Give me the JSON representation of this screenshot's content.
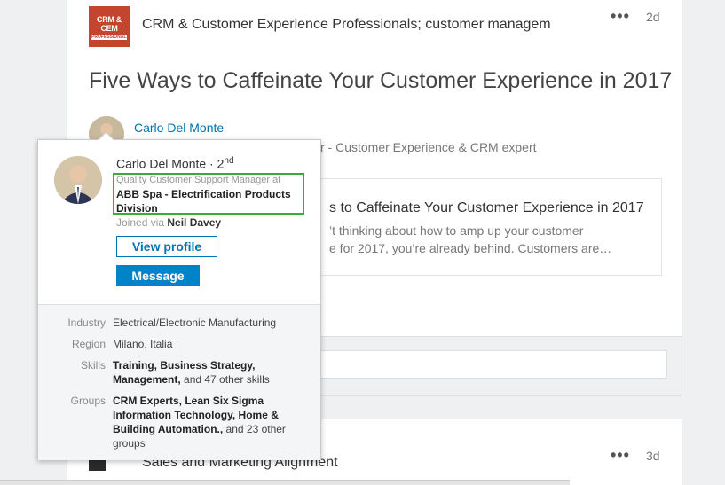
{
  "feed": {
    "post1": {
      "group_name": "CRM & Customer Experience Professionals; customer managem",
      "group_logo_text": "CRM & CEM",
      "group_logo_subtext": "PROFESSIONALS",
      "more_label": "•••",
      "age": "2d",
      "title": "Five Ways to Caffeinate Your Customer Experience in 2017",
      "author_name": "Carlo Del Monte",
      "author_headline": "r - Customer Experience & CRM expert",
      "article_title": "s to Caffeinate Your Customer Experience in 2017",
      "article_snippet_line1": "’t thinking about how to amp up your customer",
      "article_snippet_line2": "e for 2017, you’re already behind. Customers are…"
    },
    "post2": {
      "title": "Sales and Marketing Alignment",
      "more_label": "•••",
      "age": "3d"
    }
  },
  "hovercard": {
    "name": "Carlo Del Monte",
    "degree_sep": " · ",
    "degree": "2",
    "degree_suffix": "nd",
    "job_title": "Quality Customer Support Manager at",
    "company": "ABB Spa - Electrification Products Division",
    "joined_prefix": "Joined via ",
    "joined_via": "Neil Davey",
    "view_profile_label": "View profile",
    "message_label": "Message",
    "details": {
      "industry_label": "Industry",
      "industry": "Electrical/Electronic Manufacturing",
      "region_label": "Region",
      "region": "Milano, Italia",
      "skills_label": "Skills",
      "skills_bold": "Training, Business Strategy, Management,",
      "skills_rest": " and 47 other skills",
      "groups_label": "Groups",
      "groups_bold": "CRM Experts, Lean Six Sigma Information Technology, Home & Building Automation.,",
      "groups_rest": " and 23 other groups"
    }
  },
  "colors": {
    "link_blue": "#0073b1",
    "button_blue": "#0084c7",
    "highlight_green": "#3ea83e",
    "logo_red": "#c4452d"
  }
}
